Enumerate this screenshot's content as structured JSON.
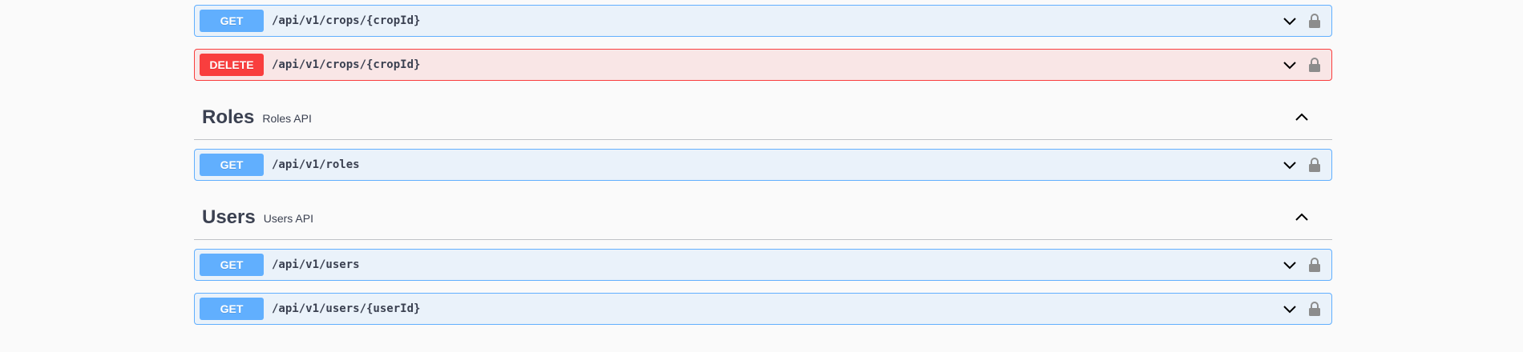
{
  "operations_before": [
    {
      "method": "GET",
      "path": "/api/v1/crops/{cropId}"
    },
    {
      "method": "DELETE",
      "path": "/api/v1/crops/{cropId}"
    }
  ],
  "roles": {
    "title": "Roles",
    "description": "Roles API",
    "operations": [
      {
        "method": "GET",
        "path": "/api/v1/roles"
      }
    ]
  },
  "users": {
    "title": "Users",
    "description": "Users API",
    "operations": [
      {
        "method": "GET",
        "path": "/api/v1/users"
      },
      {
        "method": "GET",
        "path": "/api/v1/users/{userId}"
      }
    ]
  },
  "colors": {
    "get": "#61affe",
    "delete": "#f93e3e",
    "text": "#3b4151",
    "lock": "#8c8c8c"
  },
  "icons": {
    "expand": "chevron-down-icon",
    "collapse": "chevron-up-icon",
    "auth": "lock-icon"
  }
}
